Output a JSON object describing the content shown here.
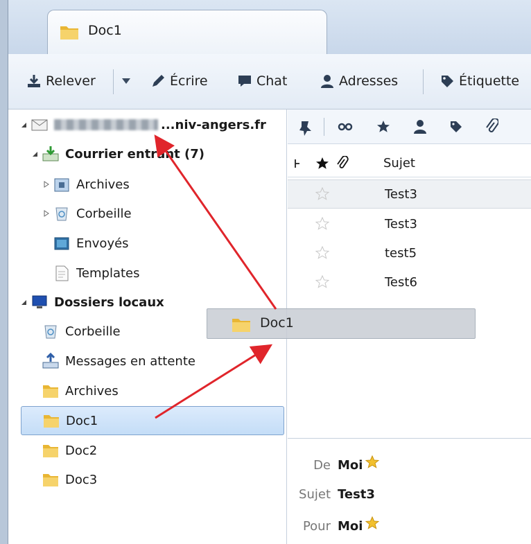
{
  "window": {
    "tab_label": "Doc1"
  },
  "toolbar": {
    "relever": "Relever",
    "ecrire": "Écrire",
    "chat": "Chat",
    "adresses": "Adresses",
    "etiquette": "Étiquette"
  },
  "folder_tree": {
    "account_name": "...niv-angers.fr",
    "items": [
      {
        "label": "Courrier entrant (7)",
        "bold": true
      },
      {
        "label": "Archives"
      },
      {
        "label": "Corbeille"
      },
      {
        "label": "Envoyés"
      },
      {
        "label": "Templates"
      },
      {
        "label": "Dossiers locaux",
        "bold": true
      },
      {
        "label": "Corbeille"
      },
      {
        "label": "Messages en attente"
      },
      {
        "label": "Archives"
      },
      {
        "label": "Doc1",
        "selected": true
      },
      {
        "label": "Doc2"
      },
      {
        "label": "Doc3"
      }
    ]
  },
  "message_list": {
    "column_subject": "Sujet",
    "rows": [
      {
        "subject": "Test3",
        "selected": true
      },
      {
        "subject": "Test3"
      },
      {
        "subject": "test5"
      },
      {
        "subject": "Test6"
      }
    ]
  },
  "drag_ghost": {
    "label": "Doc1"
  },
  "message_header": {
    "from_label": "De",
    "from_value": "Moi",
    "subject_label": "Sujet",
    "subject_value": "Test3",
    "to_label": "Pour",
    "to_value": "Moi"
  },
  "colors": {
    "accent": "#3a6db5",
    "arrow": "#e0252b",
    "selection": "#c4ddf7"
  }
}
